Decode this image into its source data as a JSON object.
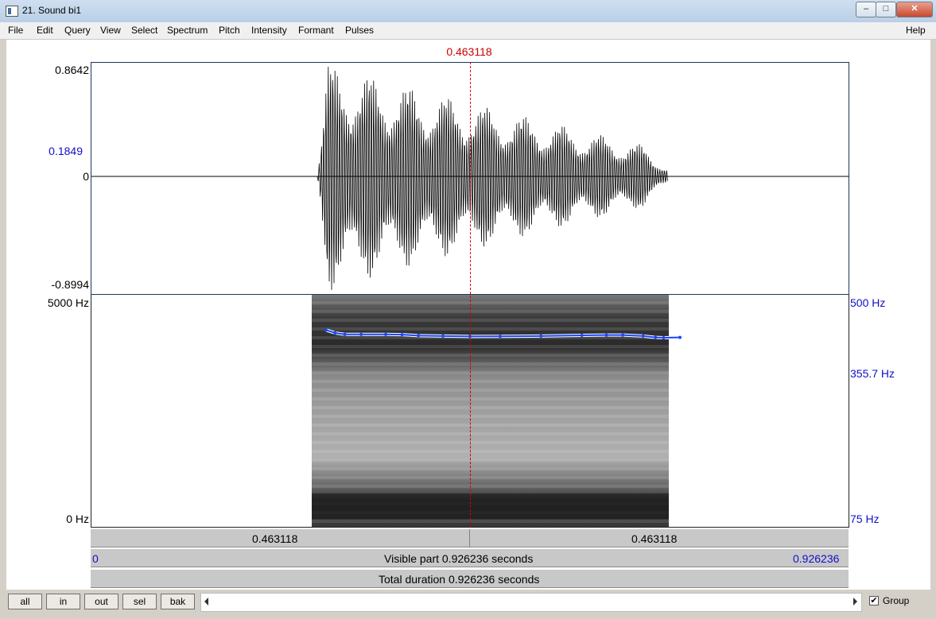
{
  "window": {
    "title": "21. Sound bi1"
  },
  "menu": {
    "items": [
      "File",
      "Edit",
      "Query",
      "View",
      "Select",
      "Spectrum",
      "Pitch",
      "Intensity",
      "Formant",
      "Pulses"
    ],
    "help": "Help"
  },
  "cursor": {
    "time": "0.463118"
  },
  "waveform": {
    "max_label": "0.8642",
    "cursor_value_label": "0.1849",
    "zero_label": "0",
    "min_label": "-0.8994"
  },
  "spectrogram": {
    "top_freq": "5000 Hz",
    "bottom_freq": "0 Hz",
    "pitch_top": "500 Hz",
    "pitch_value": "355.7 Hz",
    "pitch_bottom": "75 Hz",
    "pitch_color": "#1a46ff"
  },
  "chart_data": {
    "type": "line",
    "title": "",
    "xlabel": "",
    "ylabel": "",
    "xlim": [
      0,
      0.926236
    ],
    "ylim": [
      75,
      500
    ],
    "series": [
      {
        "x": [
          0.287,
          0.298,
          0.31,
          0.33,
          0.36,
          0.38,
          0.4,
          0.43,
          0.463,
          0.5,
          0.55,
          0.6,
          0.63,
          0.65,
          0.675,
          0.69,
          0.7,
          0.72
        ],
        "y": [
          375,
          366,
          362,
          362,
          362,
          361,
          358,
          357,
          355.7,
          356,
          357,
          359,
          360,
          360,
          357,
          353,
          352,
          353
        ]
      }
    ]
  },
  "bars": {
    "left_segment": "0.463118",
    "right_segment": "0.463118",
    "visible_start": "0",
    "visible_text": "Visible part 0.926236 seconds",
    "visible_end": "0.926236",
    "total_text": "Total duration 0.926236 seconds"
  },
  "bottom": {
    "buttons": [
      "all",
      "in",
      "out",
      "sel",
      "bak"
    ],
    "group_label": "Group",
    "group_checked": true
  }
}
